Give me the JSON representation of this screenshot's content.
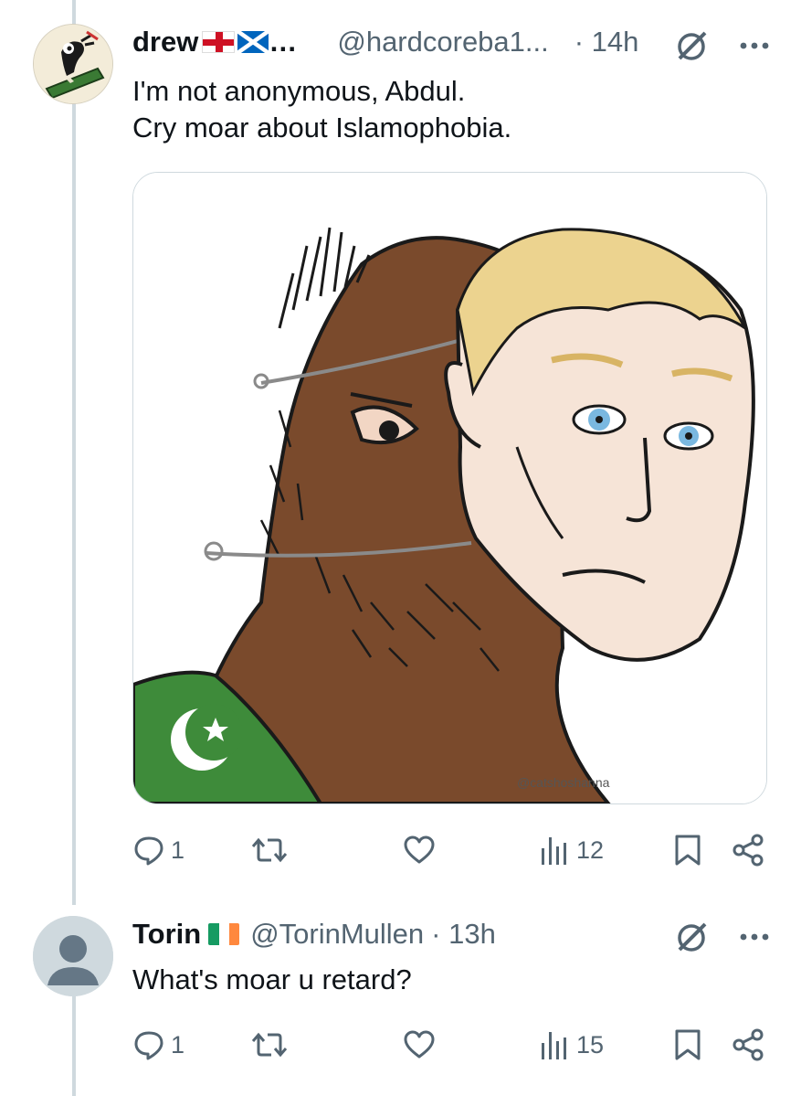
{
  "tweets": [
    {
      "name": "drew",
      "handle": "@hardcoreba1...",
      "time": "· 14h",
      "text_line1": "I'm not anonymous, Abdul.",
      "text_line2": "Cry moar about Islamophobia.",
      "media_watermark": "@catshoshanna",
      "replies": "1",
      "reposts": "",
      "likes": "",
      "views": "12"
    },
    {
      "name": "Torin",
      "handle": "@TorinMullen",
      "time": "· 13h",
      "text": "What's moar u retard?",
      "replies": "1",
      "reposts": "",
      "likes": "",
      "views": "15"
    }
  ],
  "colors": {
    "text": "#0f1419",
    "secondary": "#536471",
    "thread_line": "#cfd9de",
    "skin_brown": "#7a4a2c",
    "skin_light": "#f6e4d7",
    "hair_blond": "#ecd38f",
    "green_flag": "#3e8b3a",
    "eye_blue": "#7ab8e0"
  },
  "icons": {
    "reply": "speech-bubble-icon",
    "repost": "repost-arrows-icon",
    "like": "heart-icon",
    "views": "bar-chart-icon",
    "bookmark": "bookmark-icon",
    "share": "share-icon",
    "grok": "grok-slash-circle-icon",
    "more": "more-dots-icon"
  }
}
